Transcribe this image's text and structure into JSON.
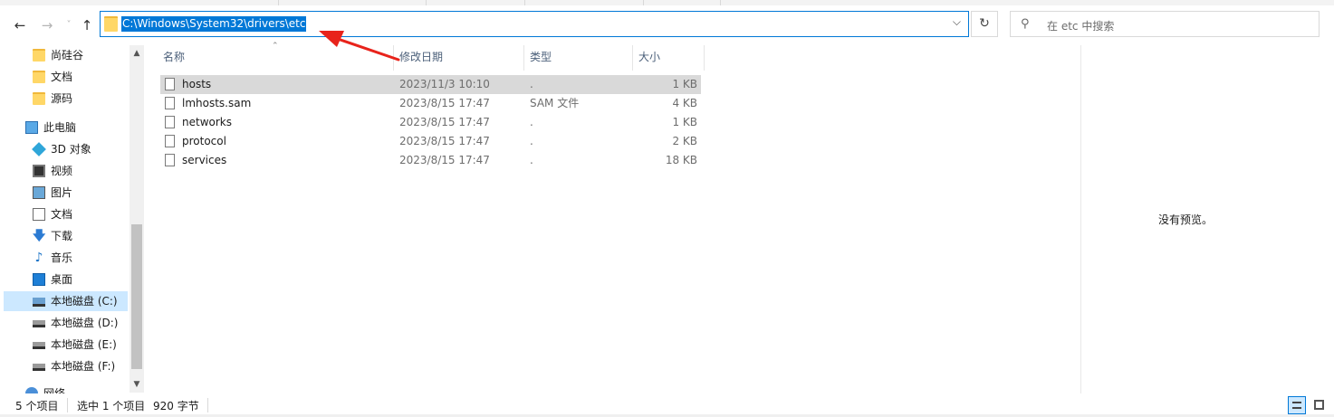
{
  "nav": {
    "back_glyph": "←",
    "forward_glyph": "→",
    "history_glyph": "˅",
    "up_glyph": "↑",
    "address_path": "C:\\Windows\\System32\\drivers\\etc",
    "address_chevron": "⌵",
    "refresh_glyph": "↻",
    "search_glyph": "⚲",
    "search_placeholder": "在 etc 中搜索"
  },
  "sidebar": {
    "items": [
      {
        "label": "尚硅谷",
        "icon": "folder-icon"
      },
      {
        "label": "文档",
        "icon": "folder-icon"
      },
      {
        "label": "源码",
        "icon": "folder-icon"
      },
      {
        "label": "此电脑",
        "icon": "computer-icon"
      },
      {
        "label": "3D 对象",
        "icon": "3d-objects-icon"
      },
      {
        "label": "视频",
        "icon": "video-icon"
      },
      {
        "label": "图片",
        "icon": "pictures-icon"
      },
      {
        "label": "文档",
        "icon": "documents-icon"
      },
      {
        "label": "下载",
        "icon": "download-icon"
      },
      {
        "label": "音乐",
        "icon": "music-icon"
      },
      {
        "label": "桌面",
        "icon": "desktop-icon"
      },
      {
        "label": "本地磁盘 (C:)",
        "icon": "drive-icon",
        "selected": true
      },
      {
        "label": "本地磁盘 (D:)",
        "icon": "drive-icon"
      },
      {
        "label": "本地磁盘 (E:)",
        "icon": "drive-icon"
      },
      {
        "label": "本地磁盘 (F:)",
        "icon": "drive-icon"
      },
      {
        "label": "网络",
        "icon": "network-icon"
      }
    ],
    "download_glyph": "🡇",
    "music_glyph": "♪",
    "scroll_up_glyph": "▲",
    "scroll_down_glyph": "▼"
  },
  "columns": {
    "name": "名称",
    "date": "修改日期",
    "type": "类型",
    "size": "大小",
    "sort_glyph": "⌃"
  },
  "files": [
    {
      "name": "hosts",
      "date": "2023/11/3 10:10",
      "type": ".",
      "size": "1 KB",
      "selected": true
    },
    {
      "name": "lmhosts.sam",
      "date": "2023/8/15 17:47",
      "type": "SAM 文件",
      "size": "4 KB"
    },
    {
      "name": "networks",
      "date": "2023/8/15 17:47",
      "type": ".",
      "size": "1 KB"
    },
    {
      "name": "protocol",
      "date": "2023/8/15 17:47",
      "type": ".",
      "size": "2 KB"
    },
    {
      "name": "services",
      "date": "2023/8/15 17:47",
      "type": ".",
      "size": "18 KB"
    }
  ],
  "preview": {
    "empty_text": "没有预览。"
  },
  "status": {
    "item_count": "5 个项目",
    "selection": "选中 1 个项目",
    "selection_size": "920 字节"
  },
  "colors": {
    "accent": "#0078d7",
    "selection": "#cce8ff",
    "row_selected": "#d9d9d9",
    "annotation_arrow": "#e8231b"
  }
}
